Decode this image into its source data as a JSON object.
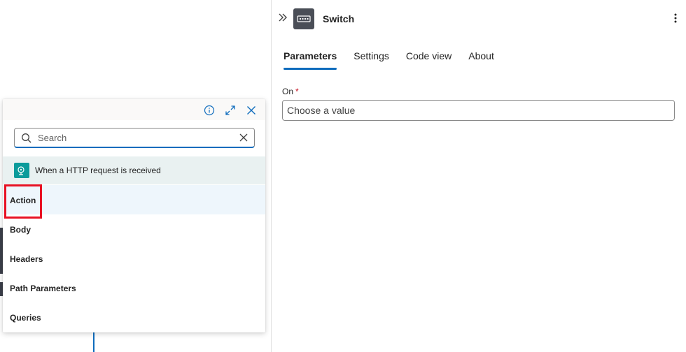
{
  "panel": {
    "title": "Switch",
    "tabs": [
      {
        "label": "Parameters",
        "active": true
      },
      {
        "label": "Settings",
        "active": false
      },
      {
        "label": "Code view",
        "active": false
      },
      {
        "label": "About",
        "active": false
      }
    ],
    "field": {
      "label": "On",
      "required_mark": "*",
      "placeholder": "Choose a value"
    }
  },
  "popup": {
    "search": {
      "placeholder": "Search",
      "value": ""
    },
    "trigger": {
      "label": "When a HTTP request is received"
    },
    "items": [
      {
        "label": "Action"
      },
      {
        "label": "Body"
      },
      {
        "label": "Headers"
      },
      {
        "label": "Path Parameters"
      },
      {
        "label": "Queries"
      }
    ]
  },
  "colors": {
    "accent": "#0f6cbd",
    "trigger_icon": "#0b9b9b",
    "highlight": "#e81123",
    "node_icon": "#4a4e57"
  },
  "icons": {
    "collapse": "double-chevron-right-icon",
    "node": "switch-icon",
    "more": "more-vertical-icon",
    "info": "info-icon",
    "expand": "expand-icon",
    "close": "close-icon",
    "search": "search-icon",
    "clear": "dismiss-icon",
    "trigger": "http-request-icon"
  }
}
